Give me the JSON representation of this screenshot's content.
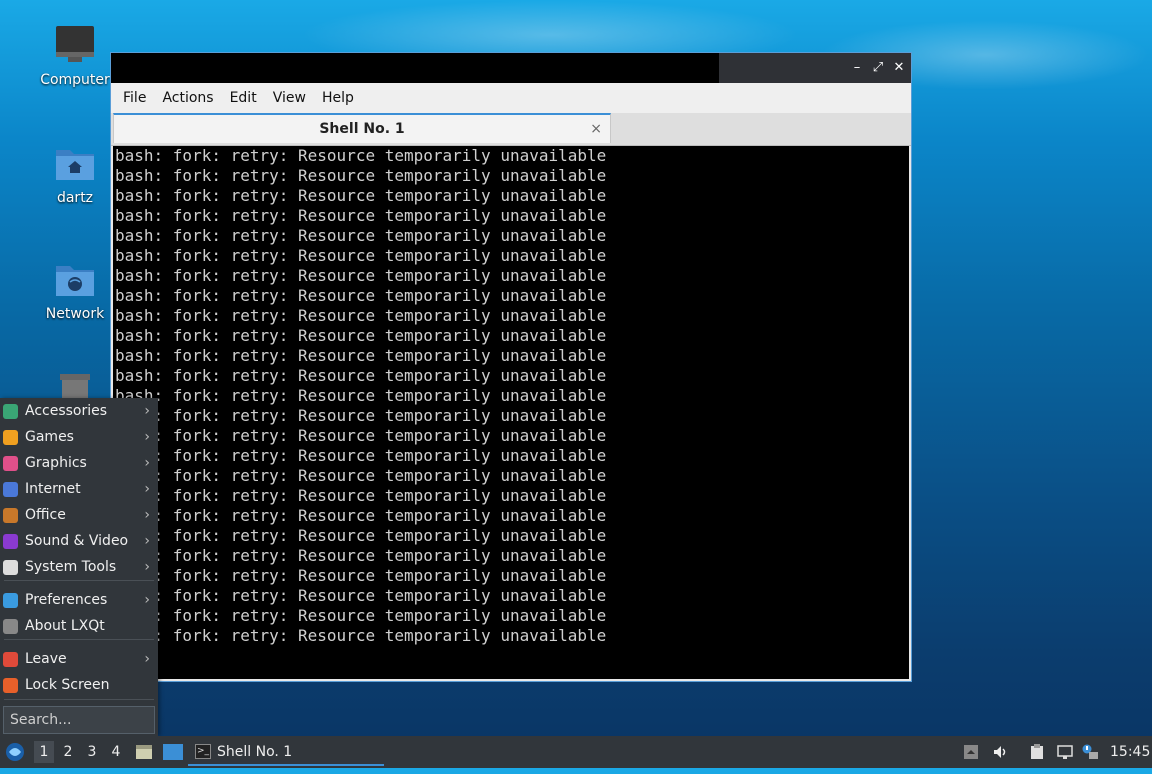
{
  "desktop": {
    "icons": [
      {
        "label": "Computer"
      },
      {
        "label": "dartz"
      },
      {
        "label": "Network"
      },
      {
        "label": "Trash"
      }
    ]
  },
  "window": {
    "controls": {
      "minimize": "–",
      "maximize": "⤢",
      "close": "✕"
    },
    "menu": [
      "File",
      "Actions",
      "Edit",
      "View",
      "Help"
    ],
    "tab": {
      "title": "Shell No. 1",
      "close": "×"
    },
    "terminal_line": "bash: fork: retry: Resource temporarily unavailable",
    "terminal_line_count": 25
  },
  "app_menu": {
    "items": [
      {
        "label": "Accessories",
        "submenu": true,
        "color": "#3aa675"
      },
      {
        "label": "Games",
        "submenu": true,
        "color": "#f0a020"
      },
      {
        "label": "Graphics",
        "submenu": true,
        "color": "#e0508a"
      },
      {
        "label": "Internet",
        "submenu": true,
        "color": "#4a78d8"
      },
      {
        "label": "Office",
        "submenu": true,
        "color": "#c8782a"
      },
      {
        "label": "Sound & Video",
        "submenu": true,
        "color": "#8a3ad0"
      },
      {
        "label": "System Tools",
        "submenu": true,
        "color": "#dddddd"
      },
      {
        "label": "Preferences",
        "submenu": true,
        "color": "#3a9be0"
      },
      {
        "label": "About LXQt",
        "submenu": false,
        "color": "#888888"
      },
      {
        "label": "Leave",
        "submenu": true,
        "color": "#e04a3a"
      },
      {
        "label": "Lock Screen",
        "submenu": false,
        "color": "#e8602a"
      }
    ],
    "search_placeholder": "Search..."
  },
  "taskbar": {
    "workspaces": [
      "1",
      "2",
      "3",
      "4"
    ],
    "active_workspace": "1",
    "task_label": "Shell No. 1",
    "clock": "15:45"
  },
  "colors": {
    "accent": "#3b8fd6",
    "panel": "#31363b",
    "terminal_bg": "#000000",
    "terminal_fg": "#d0d0d0"
  }
}
